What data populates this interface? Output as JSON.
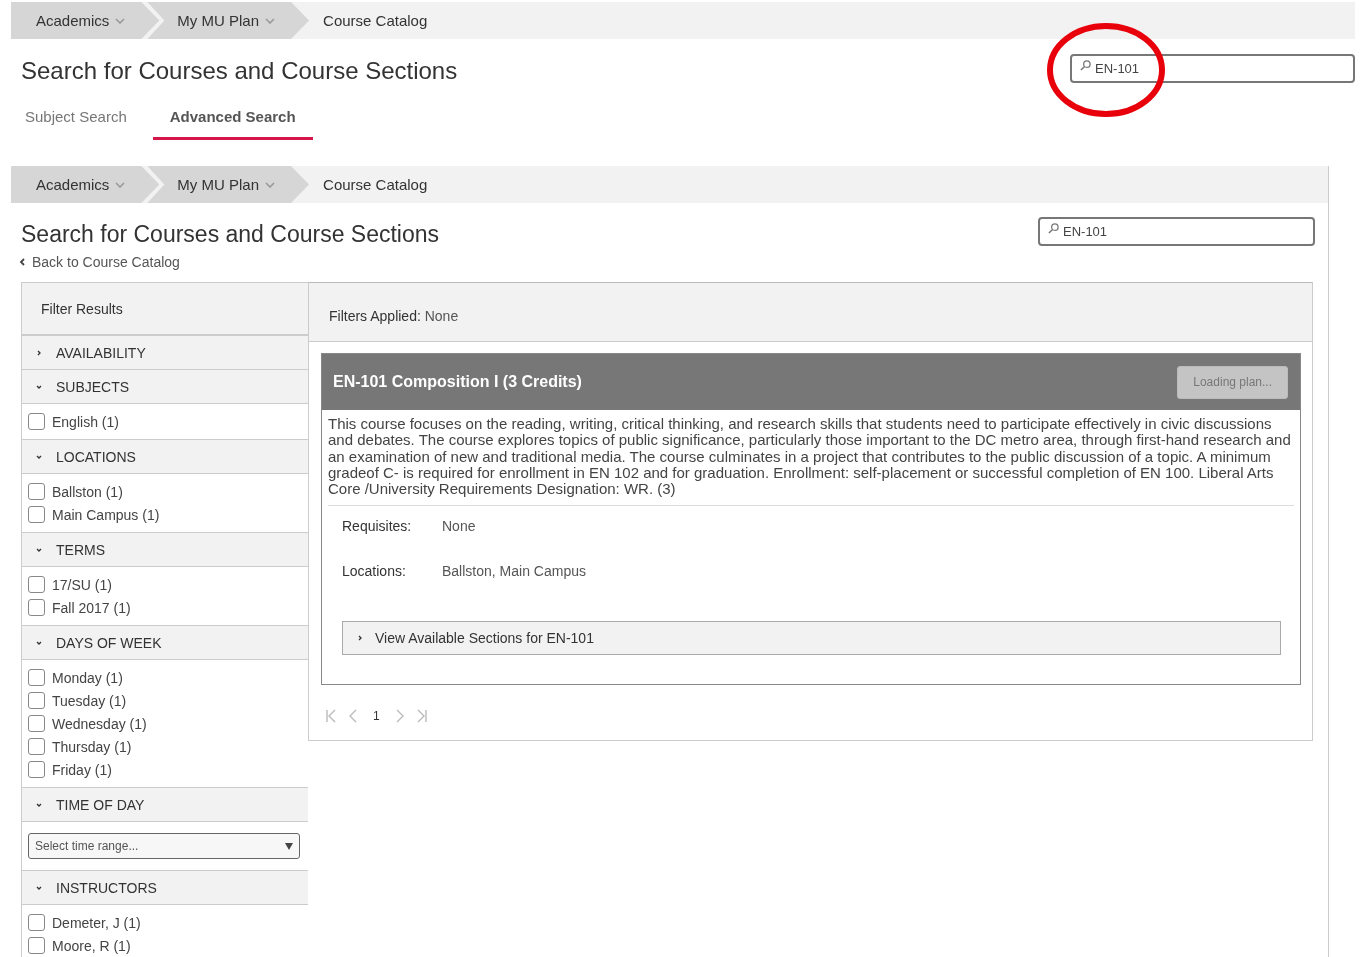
{
  "top_view": {
    "breadcrumbs": [
      {
        "label": "Academics",
        "kind": "menu"
      },
      {
        "label": "My MU Plan",
        "kind": "menu"
      },
      {
        "label": "Course Catalog",
        "kind": "current"
      }
    ],
    "title": "Search for Courses and Course Sections",
    "tabs": [
      {
        "label": "Subject Search",
        "selected": false
      },
      {
        "label": "Advanced Search",
        "selected": true
      }
    ],
    "search": {
      "value": "EN-101"
    }
  },
  "bottom_view": {
    "breadcrumbs": [
      {
        "label": "Academics",
        "kind": "menu"
      },
      {
        "label": "My MU Plan",
        "kind": "menu"
      },
      {
        "label": "Course Catalog",
        "kind": "current"
      }
    ],
    "title": "Search for Courses and Course Sections",
    "back_link": "Back to Course Catalog",
    "search": {
      "value": "EN-101"
    },
    "filter_panel": {
      "title": "Filter Results",
      "sections": [
        {
          "title": "AVAILABILITY",
          "expanded": false
        },
        {
          "title": "SUBJECTS",
          "expanded": true,
          "kind": "checkboxes",
          "items": [
            {
              "label": "English (1)",
              "checked": false
            }
          ]
        },
        {
          "title": "LOCATIONS",
          "expanded": true,
          "kind": "checkboxes",
          "items": [
            {
              "label": "Ballston (1)",
              "checked": false
            },
            {
              "label": "Main Campus (1)",
              "checked": false
            }
          ]
        },
        {
          "title": "TERMS",
          "expanded": true,
          "kind": "checkboxes",
          "items": [
            {
              "label": "17/SU (1)",
              "checked": false
            },
            {
              "label": "Fall 2017 (1)",
              "checked": false
            }
          ]
        },
        {
          "title": "DAYS OF WEEK",
          "expanded": true,
          "kind": "checkboxes",
          "items": [
            {
              "label": "Monday (1)",
              "checked": false
            },
            {
              "label": "Tuesday (1)",
              "checked": false
            },
            {
              "label": "Wednesday (1)",
              "checked": false
            },
            {
              "label": "Thursday (1)",
              "checked": false
            },
            {
              "label": "Friday (1)",
              "checked": false
            }
          ]
        },
        {
          "title": "TIME OF DAY",
          "expanded": true,
          "kind": "select",
          "placeholder": "Select time range..."
        },
        {
          "title": "INSTRUCTORS",
          "expanded": true,
          "kind": "checkboxes",
          "items": [
            {
              "label": "Demeter, J (1)",
              "checked": false
            },
            {
              "label": "Moore, R (1)",
              "checked": false
            }
          ]
        }
      ]
    },
    "results": {
      "filters_label": "Filters Applied:",
      "filters_value": "None",
      "course": {
        "title": "EN-101 Composition I (3 Credits)",
        "button": "Loading plan...",
        "description": "This course focuses on the reading, writing, critical thinking, and research skills that students need to participate effectively in civic discussions and debates. The course explores topics of public significance, particularly those important to the DC metro area, through first-hand research and an examination of new and traditional media. The course culminates in a project that contributes to the public discussion of a topic. A minimum gradeof C- is required for enrollment in EN 102 and for graduation. Enrollment: self-placement or successful completion of EN 100. Liberal Arts Core /University Requirements Designation: WR. (3)",
        "details": [
          {
            "label": "Requisites:",
            "value": "None"
          },
          {
            "label": "Locations:",
            "value": "Ballston, Main Campus"
          }
        ],
        "sections_link": "View Available Sections for EN-101"
      },
      "pagination": {
        "pages": [
          {
            "label": "1",
            "selected": true
          }
        ]
      }
    }
  }
}
